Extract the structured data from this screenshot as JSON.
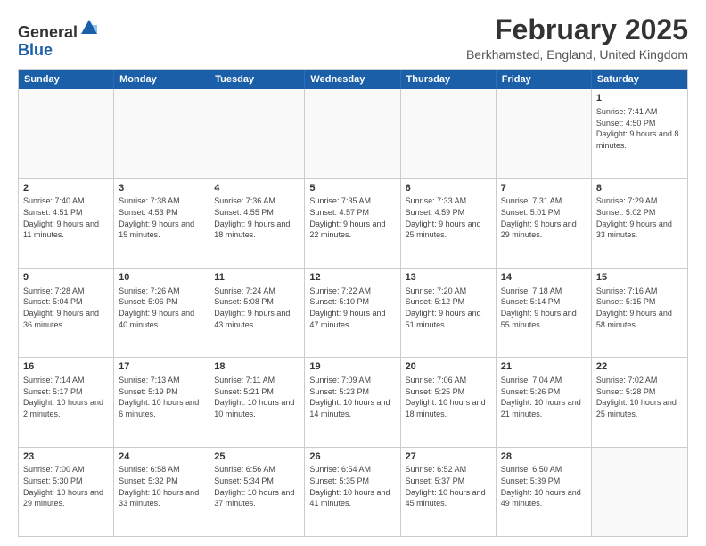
{
  "header": {
    "logo": {
      "text_general": "General",
      "text_blue": "Blue"
    },
    "title": "February 2025",
    "location": "Berkhamsted, England, United Kingdom"
  },
  "calendar": {
    "days_of_week": [
      "Sunday",
      "Monday",
      "Tuesday",
      "Wednesday",
      "Thursday",
      "Friday",
      "Saturday"
    ],
    "rows": [
      {
        "cells": [
          {
            "day": null,
            "info": null
          },
          {
            "day": null,
            "info": null
          },
          {
            "day": null,
            "info": null
          },
          {
            "day": null,
            "info": null
          },
          {
            "day": null,
            "info": null
          },
          {
            "day": null,
            "info": null
          },
          {
            "day": "1",
            "info": "Sunrise: 7:41 AM\nSunset: 4:50 PM\nDaylight: 9 hours and 8 minutes."
          }
        ]
      },
      {
        "cells": [
          {
            "day": "2",
            "info": "Sunrise: 7:40 AM\nSunset: 4:51 PM\nDaylight: 9 hours and 11 minutes."
          },
          {
            "day": "3",
            "info": "Sunrise: 7:38 AM\nSunset: 4:53 PM\nDaylight: 9 hours and 15 minutes."
          },
          {
            "day": "4",
            "info": "Sunrise: 7:36 AM\nSunset: 4:55 PM\nDaylight: 9 hours and 18 minutes."
          },
          {
            "day": "5",
            "info": "Sunrise: 7:35 AM\nSunset: 4:57 PM\nDaylight: 9 hours and 22 minutes."
          },
          {
            "day": "6",
            "info": "Sunrise: 7:33 AM\nSunset: 4:59 PM\nDaylight: 9 hours and 25 minutes."
          },
          {
            "day": "7",
            "info": "Sunrise: 7:31 AM\nSunset: 5:01 PM\nDaylight: 9 hours and 29 minutes."
          },
          {
            "day": "8",
            "info": "Sunrise: 7:29 AM\nSunset: 5:02 PM\nDaylight: 9 hours and 33 minutes."
          }
        ]
      },
      {
        "cells": [
          {
            "day": "9",
            "info": "Sunrise: 7:28 AM\nSunset: 5:04 PM\nDaylight: 9 hours and 36 minutes."
          },
          {
            "day": "10",
            "info": "Sunrise: 7:26 AM\nSunset: 5:06 PM\nDaylight: 9 hours and 40 minutes."
          },
          {
            "day": "11",
            "info": "Sunrise: 7:24 AM\nSunset: 5:08 PM\nDaylight: 9 hours and 43 minutes."
          },
          {
            "day": "12",
            "info": "Sunrise: 7:22 AM\nSunset: 5:10 PM\nDaylight: 9 hours and 47 minutes."
          },
          {
            "day": "13",
            "info": "Sunrise: 7:20 AM\nSunset: 5:12 PM\nDaylight: 9 hours and 51 minutes."
          },
          {
            "day": "14",
            "info": "Sunrise: 7:18 AM\nSunset: 5:14 PM\nDaylight: 9 hours and 55 minutes."
          },
          {
            "day": "15",
            "info": "Sunrise: 7:16 AM\nSunset: 5:15 PM\nDaylight: 9 hours and 58 minutes."
          }
        ]
      },
      {
        "cells": [
          {
            "day": "16",
            "info": "Sunrise: 7:14 AM\nSunset: 5:17 PM\nDaylight: 10 hours and 2 minutes."
          },
          {
            "day": "17",
            "info": "Sunrise: 7:13 AM\nSunset: 5:19 PM\nDaylight: 10 hours and 6 minutes."
          },
          {
            "day": "18",
            "info": "Sunrise: 7:11 AM\nSunset: 5:21 PM\nDaylight: 10 hours and 10 minutes."
          },
          {
            "day": "19",
            "info": "Sunrise: 7:09 AM\nSunset: 5:23 PM\nDaylight: 10 hours and 14 minutes."
          },
          {
            "day": "20",
            "info": "Sunrise: 7:06 AM\nSunset: 5:25 PM\nDaylight: 10 hours and 18 minutes."
          },
          {
            "day": "21",
            "info": "Sunrise: 7:04 AM\nSunset: 5:26 PM\nDaylight: 10 hours and 21 minutes."
          },
          {
            "day": "22",
            "info": "Sunrise: 7:02 AM\nSunset: 5:28 PM\nDaylight: 10 hours and 25 minutes."
          }
        ]
      },
      {
        "cells": [
          {
            "day": "23",
            "info": "Sunrise: 7:00 AM\nSunset: 5:30 PM\nDaylight: 10 hours and 29 minutes."
          },
          {
            "day": "24",
            "info": "Sunrise: 6:58 AM\nSunset: 5:32 PM\nDaylight: 10 hours and 33 minutes."
          },
          {
            "day": "25",
            "info": "Sunrise: 6:56 AM\nSunset: 5:34 PM\nDaylight: 10 hours and 37 minutes."
          },
          {
            "day": "26",
            "info": "Sunrise: 6:54 AM\nSunset: 5:35 PM\nDaylight: 10 hours and 41 minutes."
          },
          {
            "day": "27",
            "info": "Sunrise: 6:52 AM\nSunset: 5:37 PM\nDaylight: 10 hours and 45 minutes."
          },
          {
            "day": "28",
            "info": "Sunrise: 6:50 AM\nSunset: 5:39 PM\nDaylight: 10 hours and 49 minutes."
          },
          {
            "day": null,
            "info": null
          }
        ]
      }
    ]
  }
}
